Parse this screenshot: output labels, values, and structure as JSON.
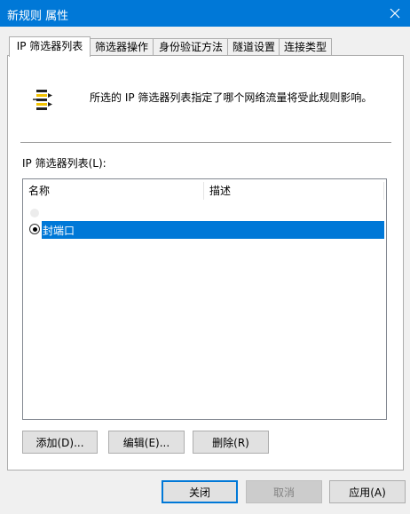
{
  "window": {
    "title": "新规则 属性",
    "close_icon": "close-icon"
  },
  "tabs": [
    {
      "label": "IP 筛选器列表",
      "active": true
    },
    {
      "label": "筛选器操作",
      "active": false
    },
    {
      "label": "身份验证方法",
      "active": false
    },
    {
      "label": "隧道设置",
      "active": false
    },
    {
      "label": "连接类型",
      "active": false
    }
  ],
  "panel": {
    "info_icon": "filter-list-icon",
    "info_text": "所选的 IP 筛选器列表指定了哪个网络流量将受此规则影响。",
    "list_label": "IP 筛选器列表(L):",
    "columns": [
      "名称",
      "描述"
    ],
    "rows": [
      {
        "name": "封端口",
        "description": "",
        "selected": true
      }
    ],
    "buttons": {
      "add": "添加(D)...",
      "edit": "编辑(E)...",
      "delete": "删除(R)"
    }
  },
  "footer": {
    "close": "关闭",
    "cancel": "取消",
    "apply": "应用(A)"
  },
  "colors": {
    "accent": "#0078d7",
    "window_bg": "#f0f0f0"
  }
}
